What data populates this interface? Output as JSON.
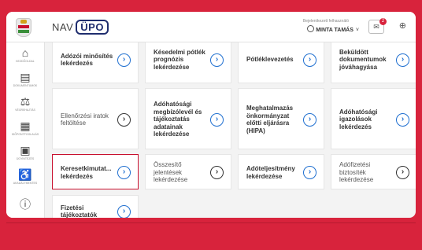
{
  "header": {
    "brand_prefix": "NAV",
    "brand_name": "ÜPO",
    "login_caption": "Bejelentkezett felhasználó",
    "user_name": "MINTA TAMÁS",
    "notification_count": "2",
    "user_chevron": "˅"
  },
  "sidebar": {
    "items": [
      {
        "icon": "home-icon",
        "glyph": "⌂",
        "label": "KEZDŐOLDAL"
      },
      {
        "icon": "documents-icon",
        "glyph": "▤",
        "label": "DOKUMENTUMOK"
      },
      {
        "icon": "cases-icon",
        "glyph": "⚖",
        "label": "VÉGREHAJTÁS"
      },
      {
        "icon": "calendar-icon",
        "glyph": "▦",
        "label": "IDŐPONTFOGLALÁS"
      },
      {
        "icon": "finance-icon",
        "glyph": "▣",
        "label": "ÜGYINTÉZÉS"
      },
      {
        "icon": "accessibility-icon",
        "glyph": "♿",
        "label": "AKADÁLYMENTES"
      },
      {
        "icon": "info-icon",
        "glyph": "ⓘ",
        "label": ""
      }
    ]
  },
  "tiles": [
    {
      "label": "Adózói minősítés\nlekérdezés",
      "selected": false,
      "soft": false
    },
    {
      "label": "Késedelmi pótlék\nprognózis\nlekérdezése",
      "selected": false,
      "soft": false
    },
    {
      "label": "Pótléklevezetés",
      "selected": false,
      "soft": false
    },
    {
      "label": "Beküldött\ndokumentumok\njóváhagyása",
      "selected": false,
      "soft": false
    },
    {
      "label": "Ellenőrzési iratok\nfeltöltése",
      "selected": false,
      "soft": true
    },
    {
      "label": "Adóhatósági\nmegbízólevél és\ntájékoztatás\nadatainak\nlekérdezése",
      "selected": false,
      "soft": false
    },
    {
      "label": "Meghatalmazás\nönkormányzat\nelőtti eljárásra\n(HIPA)",
      "selected": false,
      "soft": false
    },
    {
      "label": "Adóhatósági\nigazolások\nlekérdezés",
      "selected": false,
      "soft": false
    },
    {
      "label": "Keresetkimutat...\nlekérdezés",
      "selected": true,
      "soft": false
    },
    {
      "label": "Összesítő\njelentések\nlekérdezése",
      "selected": false,
      "soft": true
    },
    {
      "label": "Adóteljesítmény\nlekérdezése",
      "selected": false,
      "soft": false
    },
    {
      "label": "Adófizetési\nbiztosíték\nlekérdezése",
      "selected": false,
      "soft": true
    },
    {
      "label": "Fizetési\ntájékoztatók",
      "selected": false,
      "soft": false
    }
  ],
  "tile_button_glyph": "›"
}
